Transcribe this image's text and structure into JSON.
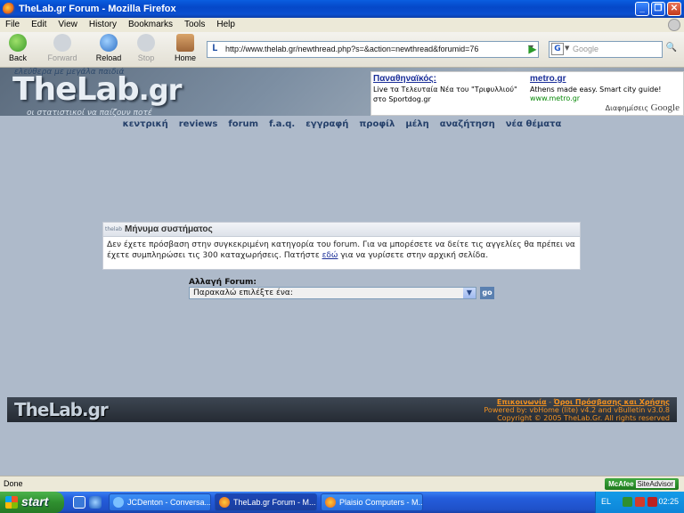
{
  "window": {
    "title": "TheLab.gr Forum - Mozilla Firefox"
  },
  "menu": [
    "File",
    "Edit",
    "View",
    "History",
    "Bookmarks",
    "Tools",
    "Help"
  ],
  "toolbar": {
    "back": "Back",
    "forward": "Forward",
    "reload": "Reload",
    "stop": "Stop",
    "home": "Home",
    "url": "http://www.thelab.gr/newthread.php?s=&action=newthread&forumid=76",
    "search_placeholder": "Google"
  },
  "site": {
    "logo": "TheLab",
    "logo_tld": ".gr",
    "slogan_top": "ελεύθερα με μεγάλα παιδιά",
    "slogan_bottom": "οι στατιστικοί να παίζουν ποτέ",
    "nav": [
      "κεντρική",
      "reviews",
      "forum",
      "f.a.q.",
      "εγγραφή",
      "προφίλ",
      "μέλη",
      "αναζήτηση",
      "νέα θέματα"
    ]
  },
  "ads": [
    {
      "title": "Παναθηναϊκός:",
      "text": "Live τα Τελευταία Νέα του \"Τριφυλλιού\" στο Sportdog.gr",
      "url": ""
    },
    {
      "title": "metro.gr",
      "text": "Athens made easy. Smart city guide!",
      "url": "www.metro.gr"
    }
  ],
  "ads_by": "Διαφημίσεις",
  "ads_by_brand": "Google",
  "message": {
    "icon_text": "thelab",
    "title": "Μήνυμα συστήματος",
    "body_pre": "Δεν έχετε πρόσβαση στην συγκεκριμένη κατηγορία του forum. Για να μπορέσετε να δείτε τις αγγελίες θα πρέπει να έχετε συμπληρώσει τις 300 καταχωρήσεις. Πατήστε ",
    "body_link": "εδώ",
    "body_post": " για να γυρίσετε στην αρχική σελίδα."
  },
  "jump": {
    "label": "Αλλαγή Forum:",
    "selected": "Παρακαλώ επιλέξτε ένα:",
    "go": "go"
  },
  "footer": {
    "logo": "TheLab",
    "logo_tld": ".gr",
    "link_contact": "Επικοινωνία",
    "link_sep": " - ",
    "link_terms": "Όροι Πρόσβασης και Χρήσης",
    "powered": "Powered by: vbHome (lite) v4.2 and vBulletin v3.0.8",
    "copyright": "Copyright © 2005 TheLab.Gr. All rights reserved"
  },
  "status": {
    "text": "Done",
    "mcafee": "McAfee",
    "mcafee_suffix": "SiteAdvisor"
  },
  "taskbar": {
    "start": "start",
    "tasks": [
      "JCDenton - Conversa...",
      "TheLab.gr Forum - M...",
      "Plaisio Computers - M..."
    ],
    "lang": "EL",
    "clock": "02:25"
  }
}
